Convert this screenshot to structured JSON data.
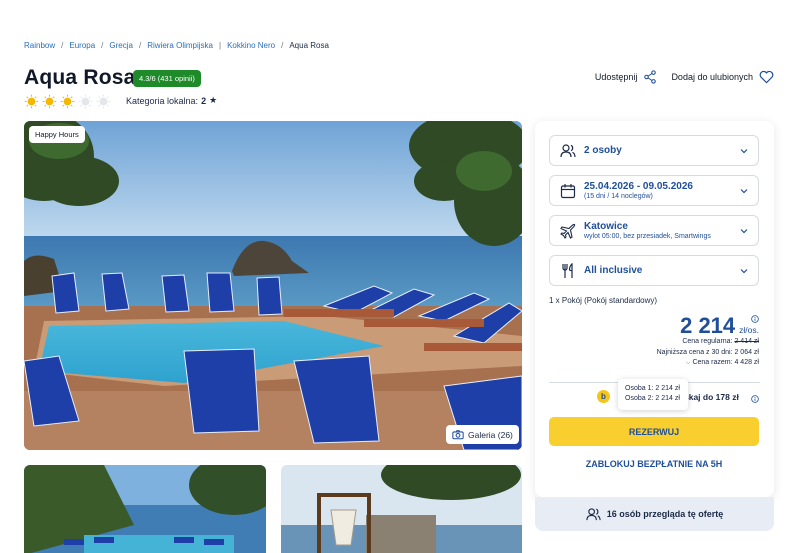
{
  "breadcrumb": {
    "items": [
      "Rainbow",
      "Europa",
      "Grecja",
      "Riwiera Olimpijska",
      "Kokkino Nero"
    ],
    "current": "Aqua Rosa"
  },
  "hotel": {
    "title": "Aqua Rosa",
    "rating_badge": "4.3/6 (431 opinii)",
    "suns_filled": 3,
    "suns_total": 5,
    "category_label": "Kategoria lokalna:",
    "category_value": "2"
  },
  "actions": {
    "share": "Udostępnij",
    "favorite": "Dodaj do ulubionych"
  },
  "gallery": {
    "happy_hours": "Happy Hours",
    "button": "Galeria (26)"
  },
  "booking": {
    "persons": "2 osoby",
    "dates_main": "25.04.2026 - 09.05.2026",
    "dates_sub": "(15 dni / 14 noclegów)",
    "departure_main": "Katowice",
    "departure_sub": "wylot 05:00, bez przesiadek, Smartwings",
    "board": "All inclusive",
    "room": "1 x Pokój  (Pokój standardowy)",
    "price": "2 214",
    "price_unit": "zł/os.",
    "regular_label": "Cena regularna:",
    "regular_price": "2 414 zł",
    "lowest_label": "Najniższa cena z 30 dni:",
    "lowest_price": "2 064 zł",
    "total_label": "Cena razem:",
    "total_price": "4 428 zł",
    "discount_suffix": "skaj do 178 zł",
    "tooltip_line1": "Osoba 1: 2 214 zł",
    "tooltip_line2": "Osoba 2: 2 214 zł",
    "reserve": "REZERWUJ",
    "block": "ZABLOKUJ BEZPŁATNIE NA 5H",
    "viewers": "16 osób przegląda tę ofertę"
  },
  "colors": {
    "accent_blue": "#1f4f9a",
    "badge_green": "#1f8a2a",
    "reserve_yellow": "#f8cf2f"
  }
}
